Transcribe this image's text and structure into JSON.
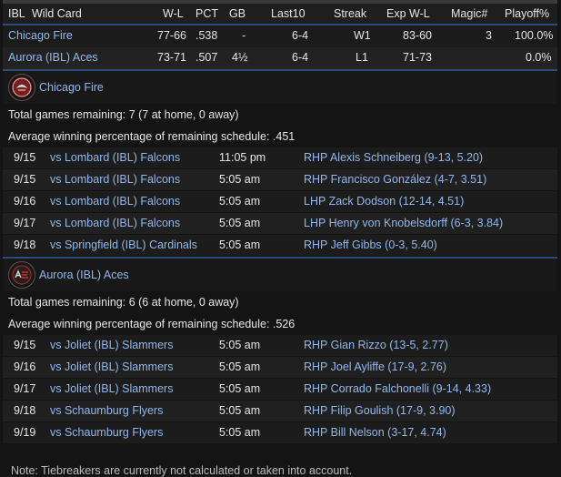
{
  "standings": {
    "headers": {
      "league": "IBL",
      "group": "Wild Card",
      "wl": "W-L",
      "pct": "PCT",
      "gb": "GB",
      "last10": "Last10",
      "streak": "Streak",
      "exp": "Exp W-L",
      "magic": "Magic#",
      "playoff": "Playoff%"
    },
    "rows": [
      {
        "team": "Chicago Fire",
        "wl": "77-66",
        "pct": ".538",
        "gb": "-",
        "last10": "6-4",
        "streak": "W1",
        "exp": "83-60",
        "magic": "3",
        "playoff": "100.0%"
      },
      {
        "team": "Aurora (IBL) Aces",
        "wl": "73-71",
        "pct": ".507",
        "gb": "4½",
        "last10": "6-4",
        "streak": "L1",
        "exp": "71-73",
        "magic": "",
        "playoff": "0.0%"
      }
    ]
  },
  "teams": [
    {
      "name": "Chicago Fire",
      "logo_icon": "chicago-fire-logo",
      "remaining": "Total games remaining: 7 (7 at home, 0 away)",
      "avg": "Average winning percentage of remaining schedule: .451",
      "games": [
        {
          "date": "9/15",
          "opp": "vs Lombard (IBL) Falcons",
          "time": "11:05 pm",
          "pitcher": "RHP Alexis Schneiberg (9-13, 5.20)"
        },
        {
          "date": "9/15",
          "opp": "vs Lombard (IBL) Falcons",
          "time": "5:05 am",
          "pitcher": "RHP Francisco González (4-7, 3.51)"
        },
        {
          "date": "9/16",
          "opp": "vs Lombard (IBL) Falcons",
          "time": "5:05 am",
          "pitcher": "LHP Zack Dodson (12-14, 4.51)"
        },
        {
          "date": "9/17",
          "opp": "vs Lombard (IBL) Falcons",
          "time": "5:05 am",
          "pitcher": "LHP Henry von Knobelsdorff (6-3, 3.84)"
        },
        {
          "date": "9/18",
          "opp": "vs Springfield (IBL) Cardinals",
          "time": "5:05 am",
          "pitcher": "RHP Jeff Gibbs (0-3, 5.40)"
        }
      ]
    },
    {
      "name": "Aurora (IBL) Aces",
      "logo_icon": "aurora-aces-logo",
      "remaining": "Total games remaining: 6 (6 at home, 0 away)",
      "avg": "Average winning percentage of remaining schedule: .526",
      "games": [
        {
          "date": "9/15",
          "opp": "vs Joliet (IBL) Slammers",
          "time": "5:05 am",
          "pitcher": "RHP Gian Rizzo (13-5, 2.77)"
        },
        {
          "date": "9/16",
          "opp": "vs Joliet (IBL) Slammers",
          "time": "5:05 am",
          "pitcher": "RHP Joel Ayliffe (17-9, 2.76)"
        },
        {
          "date": "9/17",
          "opp": "vs Joliet (IBL) Slammers",
          "time": "5:05 am",
          "pitcher": "RHP Corrado Falchonelli (9-14, 4.33)"
        },
        {
          "date": "9/18",
          "opp": "vs Schaumburg Flyers",
          "time": "5:05 am",
          "pitcher": "RHP Filip Goulish (17-9, 3.90)"
        },
        {
          "date": "9/19",
          "opp": "vs Schaumburg Flyers",
          "time": "5:05 am",
          "pitcher": "RHP Bill Nelson (3-17, 4.74)"
        }
      ]
    }
  ],
  "footnote": "Note: Tiebreakers are currently not calculated or taken into account."
}
